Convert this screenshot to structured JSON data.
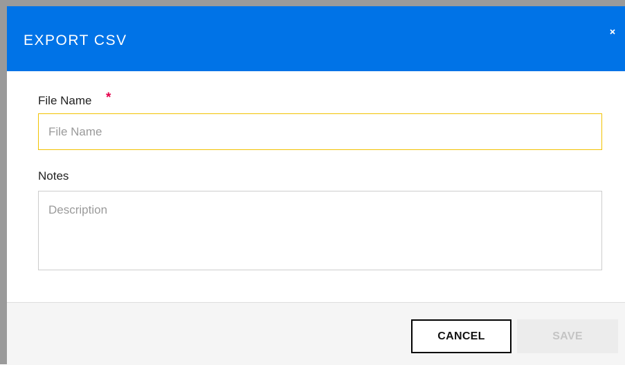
{
  "dialog": {
    "title": "EXPORT CSV",
    "close_icon": "close-icon"
  },
  "form": {
    "file_name": {
      "label": "File Name",
      "required_mark": "*",
      "value": "",
      "placeholder": "File Name"
    },
    "notes": {
      "label": "Notes",
      "value": "",
      "placeholder": "Description"
    }
  },
  "footer": {
    "cancel_label": "CANCEL",
    "save_label": "SAVE"
  },
  "colors": {
    "header_bg": "#0073e7",
    "focus_border": "#f2c200",
    "required": "#e5004c",
    "save_disabled_text": "#c4c4c4"
  }
}
